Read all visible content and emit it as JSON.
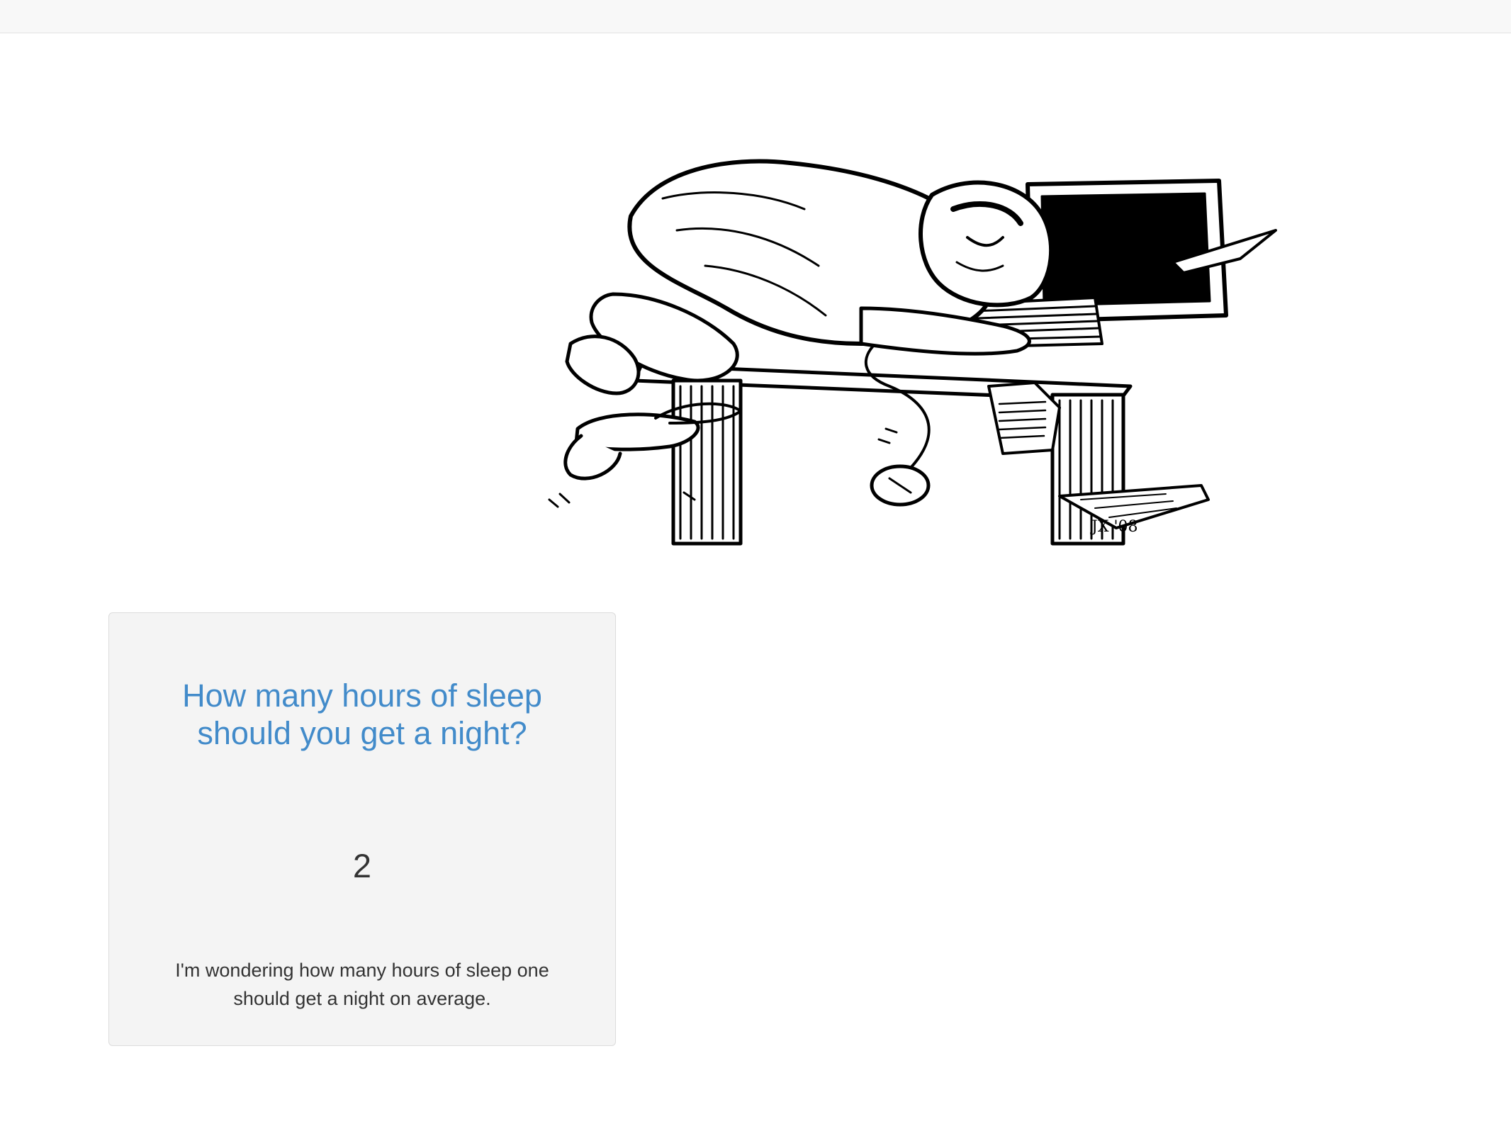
{
  "navbar": {},
  "hero_image": {
    "icon": "sleeping-at-desk-illustration",
    "signature": "JX '08"
  },
  "question_card": {
    "title": "How many hours of sleep should you get a night?",
    "count": "2",
    "description": "I'm wondering how many hours of sleep one should get a night on average.",
    "colors": {
      "title": "#428bca",
      "background": "#f4f4f4"
    }
  }
}
